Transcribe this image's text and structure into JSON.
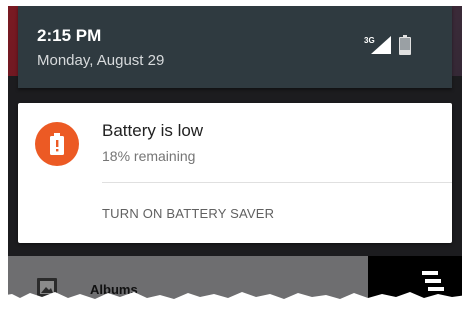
{
  "status_bar": {
    "time": "2:15 PM",
    "date": "Monday, August 29",
    "network": "3G"
  },
  "notification": {
    "title": "Battery is low",
    "subtitle": "18% remaining",
    "action_label": "TURN ON BATTERY SAVER",
    "icon": "battery-alert-icon",
    "accent_color": "#ec5a24"
  },
  "background_app": {
    "list_item_label": "Albums",
    "list_item_icon": "image-icon",
    "menu_icon": "menu-icon"
  }
}
